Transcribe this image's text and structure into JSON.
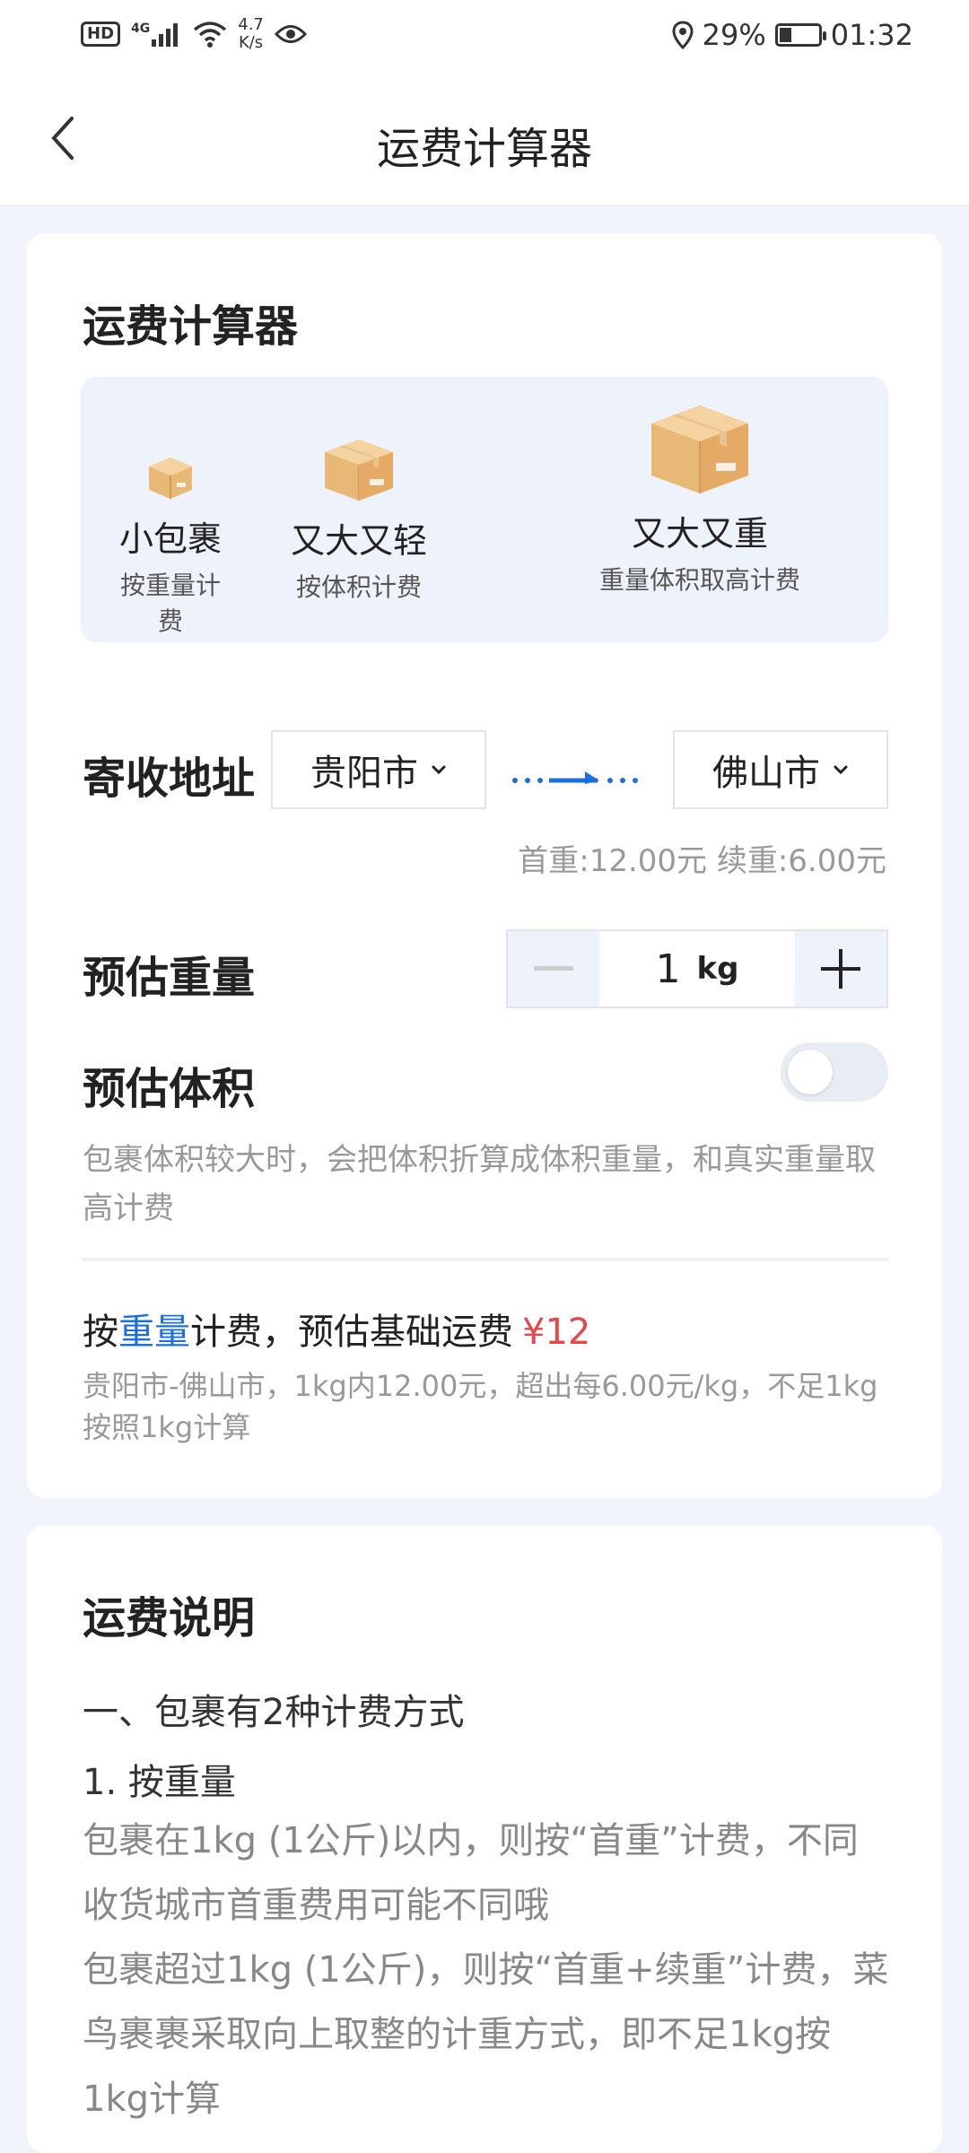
{
  "status_bar": {
    "hd": "HD",
    "network": "4G",
    "speed_value": "4.7",
    "speed_unit": "K/s",
    "battery_percent": "29%",
    "battery_level": 0.29,
    "time": "01:32"
  },
  "header": {
    "title": "运费计算器"
  },
  "calculator": {
    "title": "运费计算器",
    "packages": [
      {
        "name": "小包裹",
        "desc": "按重量计费"
      },
      {
        "name": "又大又轻",
        "desc": "按体积计费"
      },
      {
        "name": "又大又重",
        "desc": "重量体积取高计费"
      }
    ],
    "address_label": "寄收地址",
    "from_city": "贵阳市",
    "to_city": "佛山市",
    "rate_text": "首重:12.00元 续重:6.00元",
    "weight_label": "预估重量",
    "weight_value": "1",
    "weight_unit": "kg",
    "volume_label": "预估体积",
    "volume_toggle_on": false,
    "volume_desc": "包裹体积较大时，会把体积折算成体积重量，和真实重量取高计费",
    "estimate_prefix": "按",
    "estimate_mode": "重量",
    "estimate_mid": "计费，预估基础运费",
    "estimate_price": "¥12",
    "estimate_desc": "贵阳市-佛山市，1kg内12.00元，超出每6.00元/kg，不足1kg按照1kg计算"
  },
  "explanation": {
    "title": "运费说明",
    "line1": "一、包裹有2种计费方式",
    "line2": "1. 按重量",
    "para1": "包裹在1kg (1公斤)以内，则按“首重”计费，不同收货城市首重费用可能不同哦",
    "para2": "包裹超过1kg (1公斤)，则按“首重+续重”计费，菜鸟裹裹采取向上取整的计重方式，即不足1kg按1kg计算"
  },
  "colors": {
    "accent": "#1a6fe0",
    "price": "#e4484b",
    "background": "#f1f4fa"
  }
}
